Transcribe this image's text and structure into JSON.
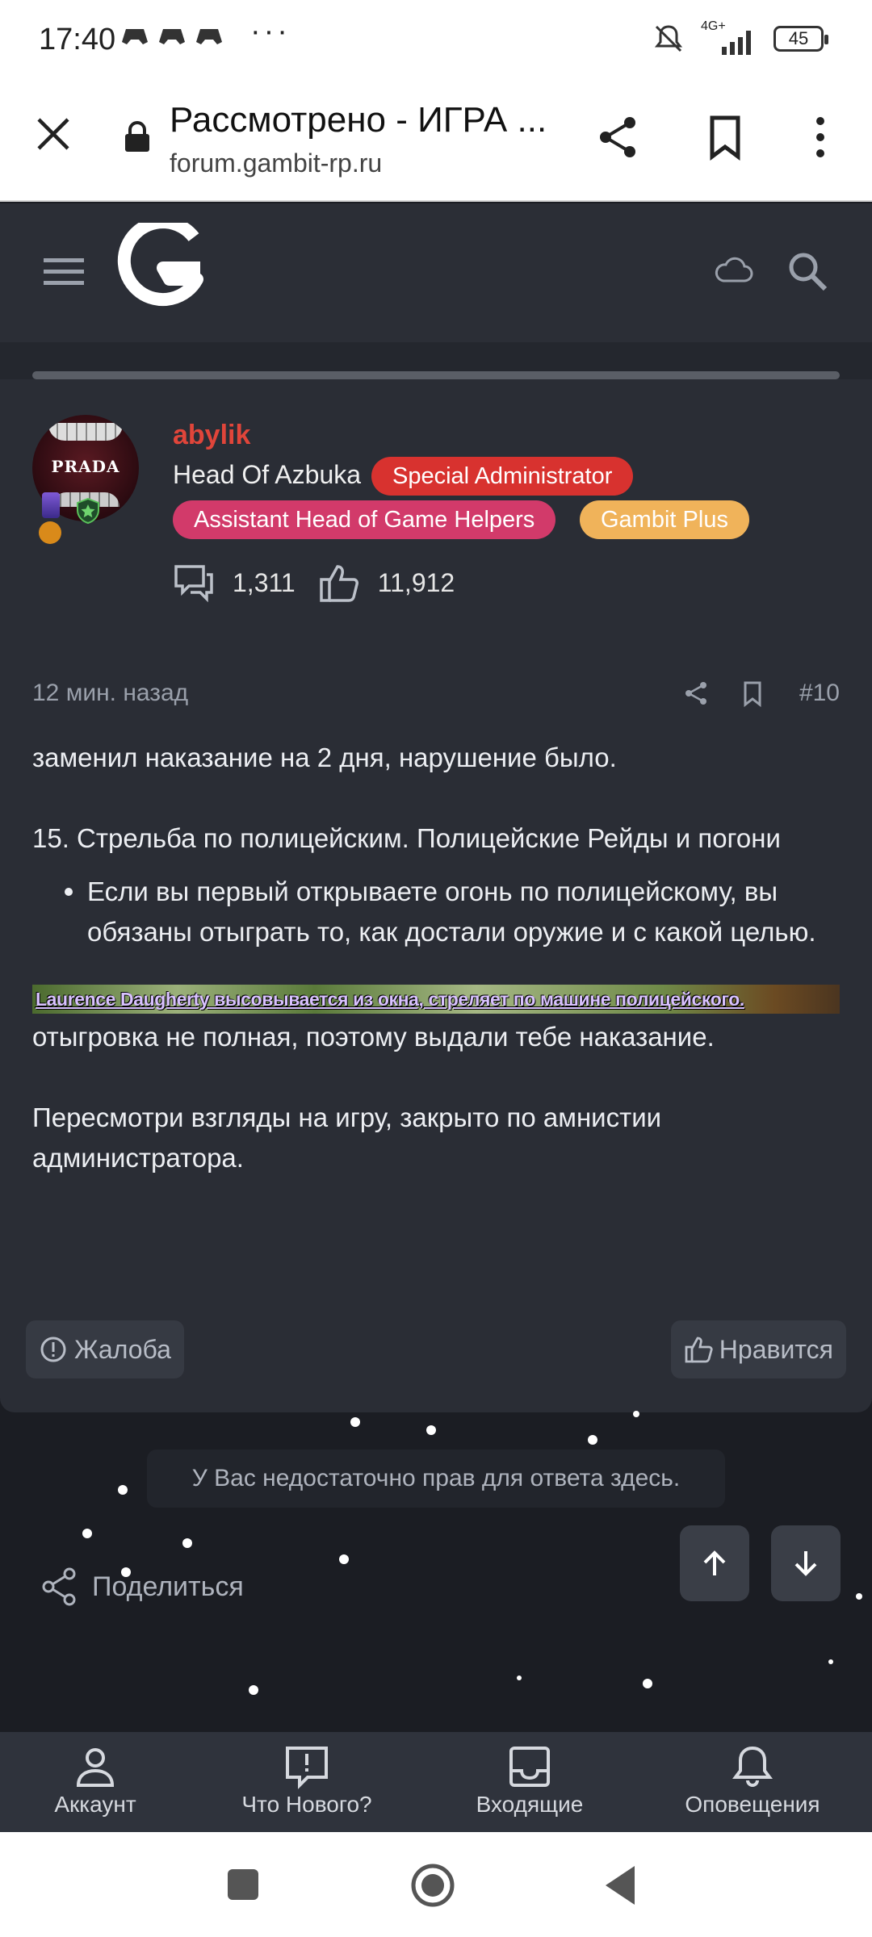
{
  "status_bar": {
    "time": "17:40",
    "more": "···",
    "network": "4G+",
    "battery": "45"
  },
  "browser": {
    "title": "Рассмотрено - ИГРА ...",
    "url": "forum.gambit-rp.ru"
  },
  "post": {
    "author": {
      "avatar_text": "PRADA",
      "username": "abylik",
      "title": "Head Of Azbuka",
      "badges": [
        "Special Administrator",
        "Assistant Head of Game Helpers",
        "Gambit Plus"
      ]
    },
    "stats": {
      "messages": "1,311",
      "reactions": "11,912"
    },
    "time_ago": "12 мин. назад",
    "post_number": "#10",
    "body": {
      "p1": "заменил наказание на 2 дня, нарушение было.",
      "p2": "15. Стрельба по полицейским. Полицейские Рейды и погони",
      "bullet": "Если вы первый открываете огонь по полицейскому, вы обязаны отыграть то, как достали оружие и с какой целью.",
      "screenshot_text": "Laurence Daugherty высовывается из окна, стреляет по машине полицейского.",
      "p3": "отыгровка не полная, поэтому выдали тебе наказание.",
      "p4": "Пересмотри взгляды на игру, закрыто по амнистии администратора."
    },
    "report_label": "Жалоба",
    "like_label": "Нравится"
  },
  "notice": "У Вас недостаточно прав для ответа здесь.",
  "share_label": "Поделиться",
  "bottom_nav": [
    {
      "label": "Аккаунт",
      "icon": "account-icon"
    },
    {
      "label": "Что Нового?",
      "icon": "whats-new-icon"
    },
    {
      "label": "Входящие",
      "icon": "inbox-icon"
    },
    {
      "label": "Оповещения",
      "icon": "bell-icon"
    }
  ],
  "colors": {
    "page_bg": "#1b1d23",
    "card_bg": "#2a2d35",
    "username": "#e0453a",
    "badge_special_admin": "#d8322f",
    "badge_assistant_head": "#d23a6a",
    "badge_gambit_plus": "#f0b35a"
  }
}
